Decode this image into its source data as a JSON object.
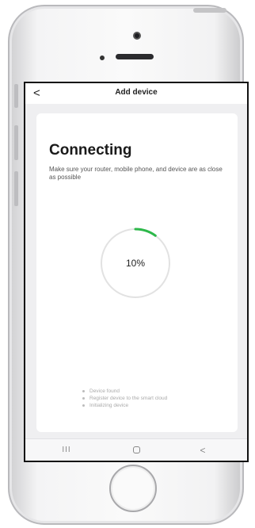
{
  "header": {
    "back_glyph": "<",
    "title": "Add device"
  },
  "connecting": {
    "title": "Connecting",
    "description": "Make sure your router, mobile phone, and device are as close as possible",
    "progress_fraction": 0.1,
    "progress_label": "10%",
    "progress_color": "#2db84a",
    "steps": [
      "Device found",
      "Register device to the smart cloud",
      "Initializing device"
    ]
  },
  "navbar": {
    "recents_glyph": "III",
    "back_glyph": "<"
  },
  "icons": {
    "back": "chevron-left-icon",
    "recents": "recents-icon",
    "home": "home-icon",
    "nav_back": "nav-back-icon"
  }
}
